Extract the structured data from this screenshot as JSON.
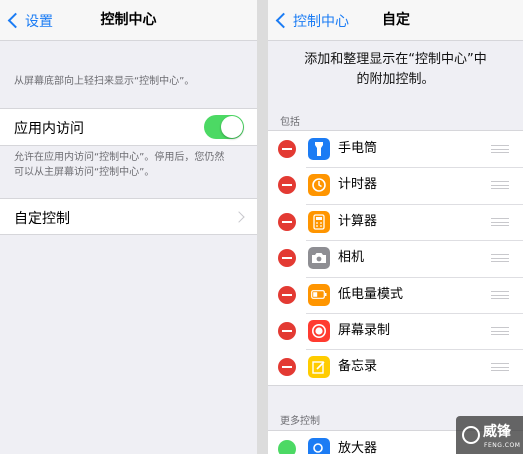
{
  "left": {
    "back_label": "设置",
    "title": "控制中心",
    "hint": "从屏幕底部向上轻扫来显示“控制中心”。",
    "access": {
      "label": "应用内访问",
      "enabled": true,
      "note_line1": "允许在应用内访问“控制中心”。停用后，您仍然",
      "note_line2": "可以从主屏幕访问“控制中心”。"
    },
    "customize_label": "自定控制"
  },
  "right": {
    "back_label": "控制中心",
    "title": "自定",
    "intro_line1": "添加和整理显示在“控制中心”中",
    "intro_line2": "的附加控制。",
    "include_header": "包括",
    "included": [
      {
        "label": "手电筒",
        "icon": "flashlight-icon",
        "color": "#1c7cf4"
      },
      {
        "label": "计时器",
        "icon": "timer-icon",
        "color": "#ff9500"
      },
      {
        "label": "计算器",
        "icon": "calculator-icon",
        "color": "#ff9500"
      },
      {
        "label": "相机",
        "icon": "camera-icon",
        "color": "#8e8e93"
      },
      {
        "label": "低电量模式",
        "icon": "battery-icon",
        "color": "#ff9500"
      },
      {
        "label": "屏幕录制",
        "icon": "screen-record-icon",
        "color": "#ff3b30"
      },
      {
        "label": "备忘录",
        "icon": "notes-icon",
        "color": "#ffcc00"
      }
    ],
    "more_header": "更多控制",
    "more": [
      {
        "label": "放大器",
        "icon": "magnifier-icon",
        "color": "#1c7cf4"
      }
    ]
  },
  "colors": {
    "accent": "#1b7cf4",
    "toggle_on": "#4cd964",
    "delete": "#e33a33"
  },
  "watermark": {
    "text": "威锋",
    "sub": "FENG.COM"
  }
}
